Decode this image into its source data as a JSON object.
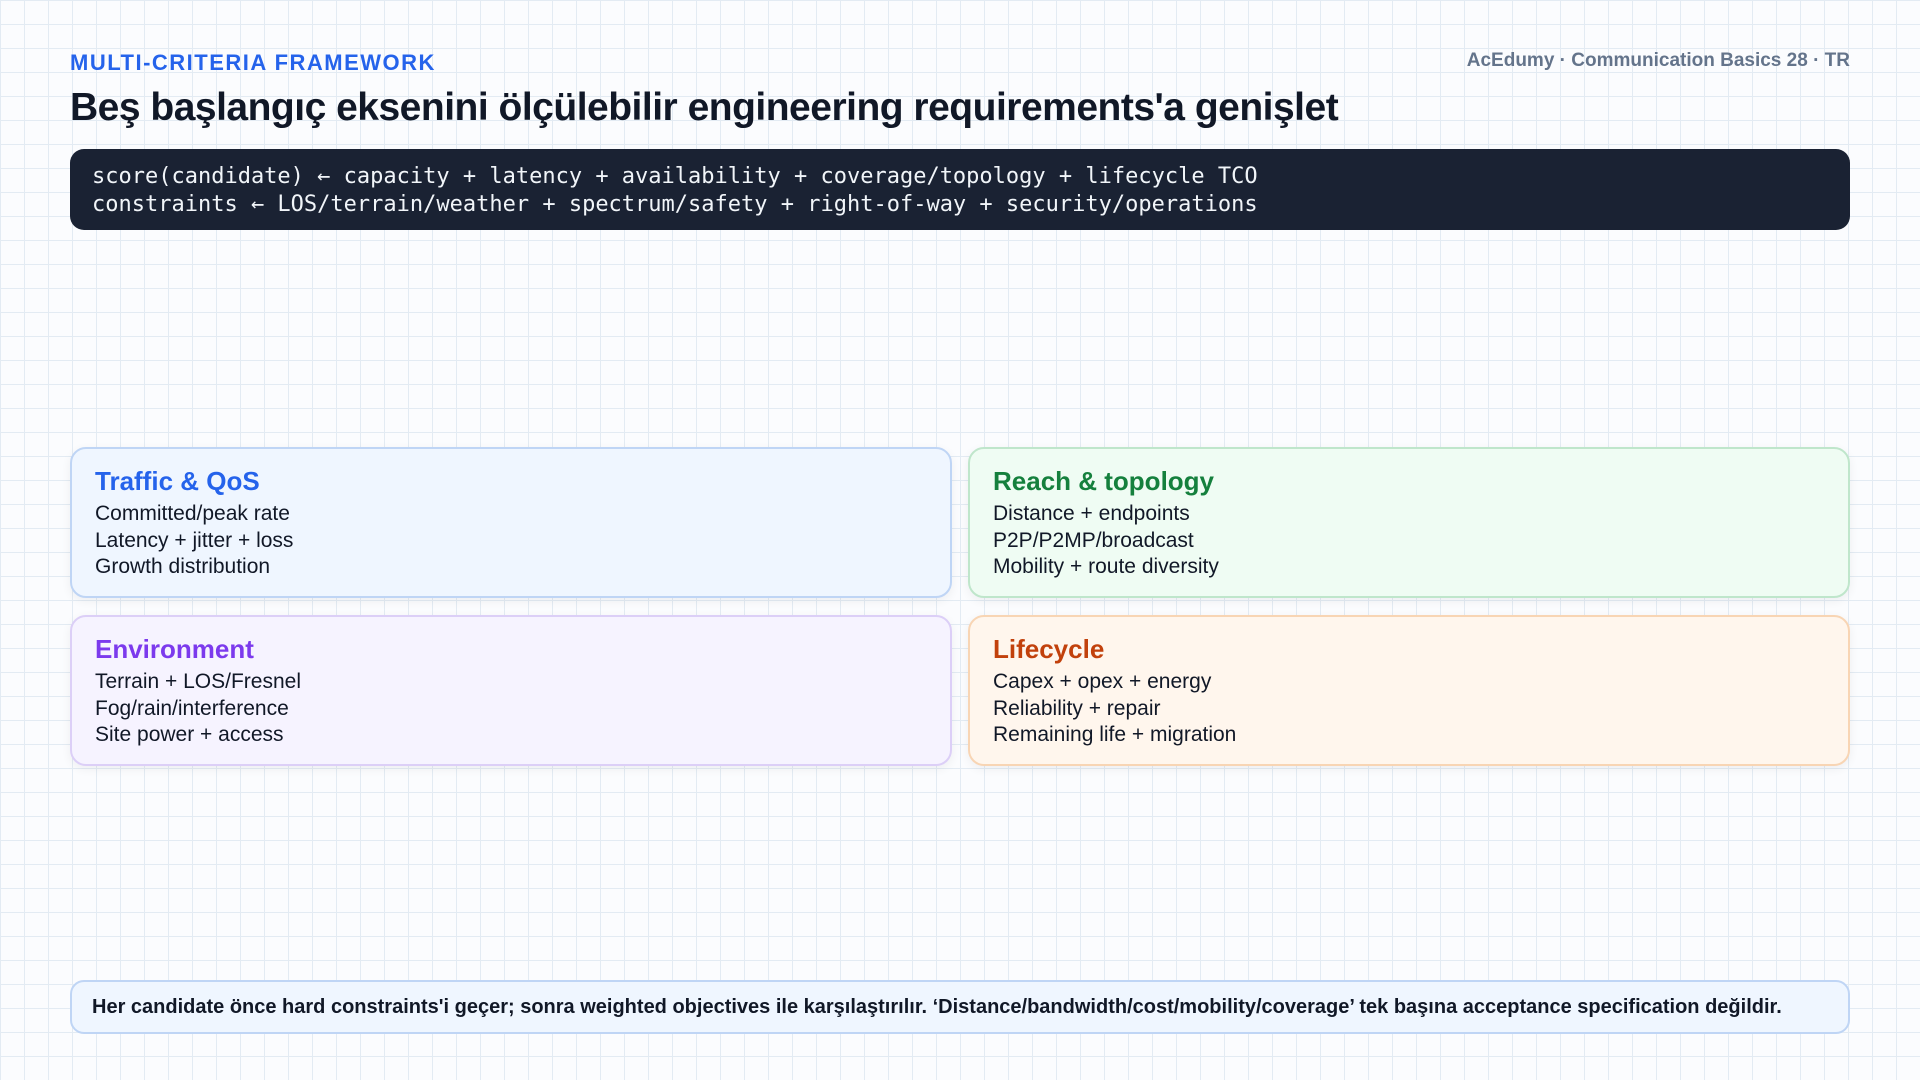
{
  "header": {
    "eyebrow": "MULTI-CRITERIA FRAMEWORK",
    "brand": "AcEdumy · Communication Basics 28 · TR",
    "title": "Beş başlangıç eksenini ölçülebilir engineering requirements'a genişlet"
  },
  "formula": {
    "line1": "score(candidate) ← capacity + latency + availability + coverage/topology + lifecycle TCO",
    "line2": "constraints ← LOS/terrain/weather + spectrum/safety + right-of-way + security/operations"
  },
  "cards": {
    "traffic": {
      "title": "Traffic & QoS",
      "lines": [
        "Committed/peak rate",
        "Latency + jitter + loss",
        "Growth distribution"
      ],
      "accent": "#2563eb"
    },
    "reach": {
      "title": "Reach & topology",
      "lines": [
        "Distance + endpoints",
        "P2P/P2MP/broadcast",
        "Mobility + route diversity"
      ],
      "accent": "#15803d"
    },
    "environment": {
      "title": "Environment",
      "lines": [
        "Terrain + LOS/Fresnel",
        "Fog/rain/interference",
        "Site power + access"
      ],
      "accent": "#7c3aed"
    },
    "lifecycle": {
      "title": "Lifecycle",
      "lines": [
        "Capex + opex + energy",
        "Reliability + repair",
        "Remaining life + migration"
      ],
      "accent": "#c2410c"
    }
  },
  "footer_note": "Her candidate önce hard constraints'i geçer; sonra weighted objectives ile karşılaştırılır. ‘Distance/bandwidth/cost/mobility/coverage’ tek başına acceptance specification değildir."
}
